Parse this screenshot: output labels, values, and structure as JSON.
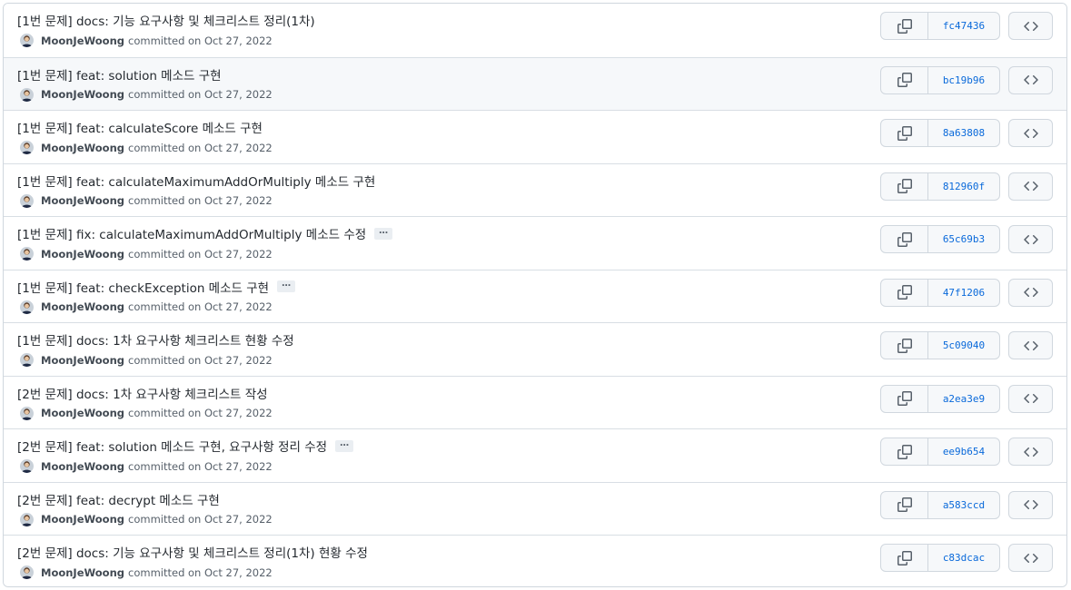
{
  "commits": [
    {
      "title": "[1번 문제] docs: 기능 요구사항 및 체크리스트 정리(1차)",
      "ellipsis": "",
      "author": "MoonJeWoong",
      "meta": "committed on Oct 27, 2022",
      "sha": "fc47436"
    },
    {
      "title": "[1번 문제] feat: solution 메소드 구현",
      "ellipsis": "",
      "author": "MoonJeWoong",
      "meta": "committed on Oct 27, 2022",
      "sha": "bc19b96"
    },
    {
      "title": "[1번 문제] feat: calculateScore 메소드 구현",
      "ellipsis": "",
      "author": "MoonJeWoong",
      "meta": "committed on Oct 27, 2022",
      "sha": "8a63808"
    },
    {
      "title": "[1번 문제] feat: calculateMaximumAddOrMultiply 메소드 구현",
      "ellipsis": "",
      "author": "MoonJeWoong",
      "meta": "committed on Oct 27, 2022",
      "sha": "812960f"
    },
    {
      "title": "[1번 문제] fix: calculateMaximumAddOrMultiply 메소드 수정",
      "ellipsis": "…",
      "author": "MoonJeWoong",
      "meta": "committed on Oct 27, 2022",
      "sha": "65c69b3"
    },
    {
      "title": "[1번 문제] feat: checkException 메소드 구현",
      "ellipsis": "…",
      "author": "MoonJeWoong",
      "meta": "committed on Oct 27, 2022",
      "sha": "47f1206"
    },
    {
      "title": "[1번 문제] docs: 1차 요구사항 체크리스트 현황 수정",
      "ellipsis": "",
      "author": "MoonJeWoong",
      "meta": "committed on Oct 27, 2022",
      "sha": "5c09040"
    },
    {
      "title": "[2번 문제] docs: 1차 요구사항 체크리스트 작성",
      "ellipsis": "",
      "author": "MoonJeWoong",
      "meta": "committed on Oct 27, 2022",
      "sha": "a2ea3e9"
    },
    {
      "title": "[2번 문제] feat: solution 메소드 구현, 요구사항 정리 수정",
      "ellipsis": "…",
      "author": "MoonJeWoong",
      "meta": "committed on Oct 27, 2022",
      "sha": "ee9b654"
    },
    {
      "title": "[2번 문제] feat: decrypt 메소드 구현",
      "ellipsis": "",
      "author": "MoonJeWoong",
      "meta": "committed on Oct 27, 2022",
      "sha": "a583ccd"
    },
    {
      "title": "[2번 문제] docs: 기능 요구사항 및 체크리스트 정리(1차) 현황 수정",
      "ellipsis": "",
      "author": "MoonJeWoong",
      "meta": "committed on Oct 27, 2022",
      "sha": "c83dcac"
    }
  ],
  "hovered_row": 1,
  "icons": {
    "copy": "copy-icon",
    "browse": "code-icon",
    "avatar": "avatar"
  },
  "colors": {
    "link": "#0969da",
    "border": "#d0d7de",
    "button_bg": "#f6f8fa",
    "hover_row_bg": "#f6f8fa"
  }
}
